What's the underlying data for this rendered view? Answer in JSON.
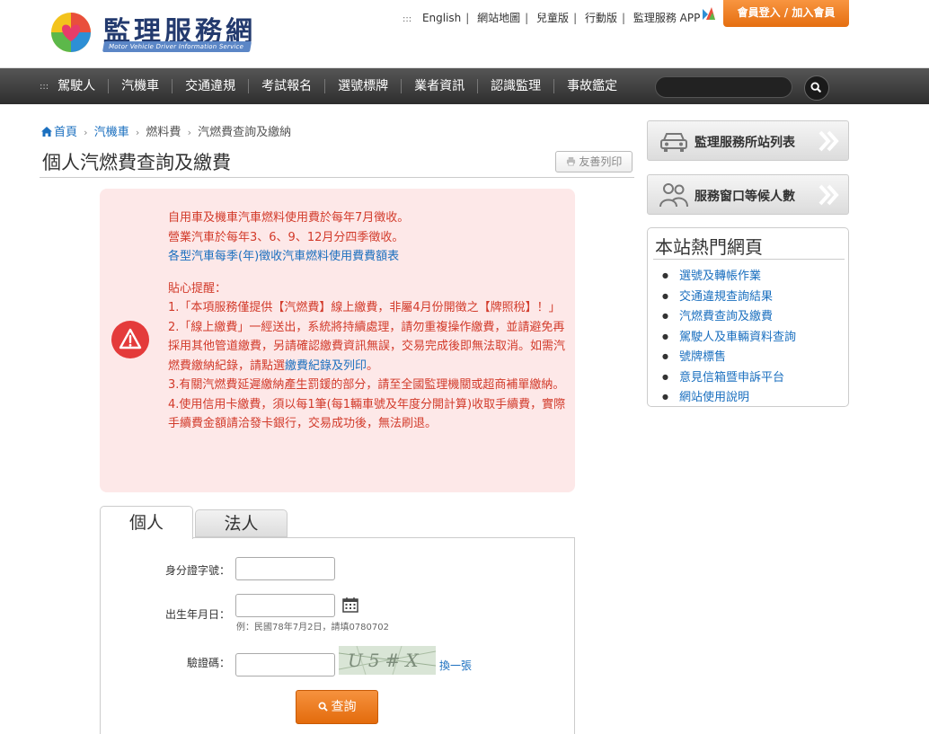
{
  "header": {
    "logo_title": "監理服務網",
    "logo_subtitle": "Motor Vehicle Driver Information Service",
    "links": [
      "English",
      "網站地圖",
      "兒童版",
      "行動版",
      "監理服務 APP"
    ],
    "login": "會員登入 / 加入會員"
  },
  "nav": {
    "items": [
      "駕駛人",
      "汽機車",
      "交通違規",
      "考試報名",
      "選號標牌",
      "業者資訊",
      "認識監理",
      "事故鑑定"
    ],
    "search_placeholder": ""
  },
  "breadcrumb": {
    "home": "首頁",
    "level1": "汽機車",
    "level2": "燃料費",
    "current": "汽燃費查詢及繳納"
  },
  "page": {
    "title": "個人汽燃費查詢及繳費",
    "print": "友善列印"
  },
  "notice": {
    "line1": "自用車及機車汽車燃料使用費於每年7月徵收。",
    "line2": "營業汽車於每年3、6、9、12月分四季徵收。",
    "link1": "各型汽車每季(年)徵收汽車燃料使用費費額表",
    "tip_title": "貼心提醒：",
    "item1": "1.「本項服務僅提供【汽燃費】線上繳費，非屬4月份開徵之【牌照稅】！」",
    "item2_a": "2.「線上繳費」一經送出，系統將持續處理，請勿重複操作繳費，並請避免再採用其他管道繳費，另請確認繳費資訊無誤，交易完成後即無法取消。如需汽燃費繳納紀錄，請點選",
    "item2_link": "繳費紀錄及列印",
    "item2_b": "。",
    "item3": "3.有關汽燃費延遲繳納產生罰鍰的部分，請至全國監理機關或超商補單繳納。",
    "item4": "4.使用信用卡繳費，須以每1筆(每1輛車號及年度分開計算)收取手續費，實際手續費金額請洽發卡銀行，交易成功後，無法刷退。"
  },
  "tabs": [
    "個人",
    "法人"
  ],
  "form": {
    "id_label": "身分證字號：",
    "birth_label": "出生年月日：",
    "birth_hint": "例：民國78年7月2日，請填0780702",
    "captcha_label": "驗證碼：",
    "captcha_text": "U5#X",
    "refresh": "換一張",
    "submit": "查詢"
  },
  "sidebar": {
    "btn1": "監理服務所站列表",
    "btn2": "服務窗口等候人數",
    "hot_title": "本站熱門網頁",
    "hot_items": [
      "選號及轉帳作業",
      "交通違規查詢結果",
      "汽燃費查詢及繳費",
      "駕駛人及車輛資料查詢",
      "號牌標售",
      "意見信箱暨申訴平台",
      "網站使用說明"
    ]
  },
  "colors": {
    "accent_orange": "#e8731a",
    "notice_red": "#d23a2a",
    "link_blue": "#1a6fbf",
    "notice_bg": "#fde8e8"
  }
}
